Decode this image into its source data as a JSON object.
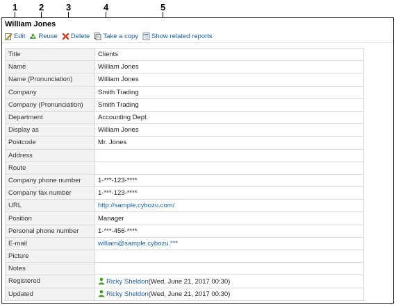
{
  "callouts": [
    "1",
    "2",
    "3",
    "4",
    "5"
  ],
  "record": {
    "title": "William Jones"
  },
  "toolbar": {
    "edit": "Edit",
    "reuse": "Reuse",
    "delete": "Delete",
    "copy": "Take a copy",
    "related": "Show related reports"
  },
  "fields": [
    {
      "label": "Title",
      "value": "Clients"
    },
    {
      "label": "Name",
      "value": "William Jones"
    },
    {
      "label": "Name (Pronunciation)",
      "value": "William Jones"
    },
    {
      "label": "Company",
      "value": "Smith Trading"
    },
    {
      "label": "Company (Pronunciation)",
      "value": "Smith Trading"
    },
    {
      "label": "Department",
      "value": "Accounting Dept."
    },
    {
      "label": "Display as",
      "value": "William Jones"
    },
    {
      "label": "Postcode",
      "value": "Mr. Jones"
    },
    {
      "label": "Address",
      "value": ""
    },
    {
      "label": "Route",
      "value": ""
    },
    {
      "label": "Company phone number",
      "value": "1-***-123-****"
    },
    {
      "label": "Company fax number",
      "value": "1-***-123-****"
    },
    {
      "label": "URL",
      "value": "http://sample.cybozu.com/"
    },
    {
      "label": "Position",
      "value": "Manager"
    },
    {
      "label": "Personal phone number",
      "value": "1-***-456-****"
    },
    {
      "label": "E-mail",
      "value": "william@sample.cybozu.***"
    },
    {
      "label": "Picture",
      "value": ""
    },
    {
      "label": "Notes",
      "value": ""
    },
    {
      "label": "Registered",
      "user": "Ricky Sheldon",
      "value": "(Wed, June 21, 2017 00:30)"
    },
    {
      "label": "Updated",
      "user": "Ricky Sheldon",
      "value": "(Wed, June 21, 2017 00:30)"
    }
  ],
  "colors": {
    "link": "#1a5fa8",
    "label_bg": "#f2f2f2",
    "border": "#d9d9d9"
  }
}
